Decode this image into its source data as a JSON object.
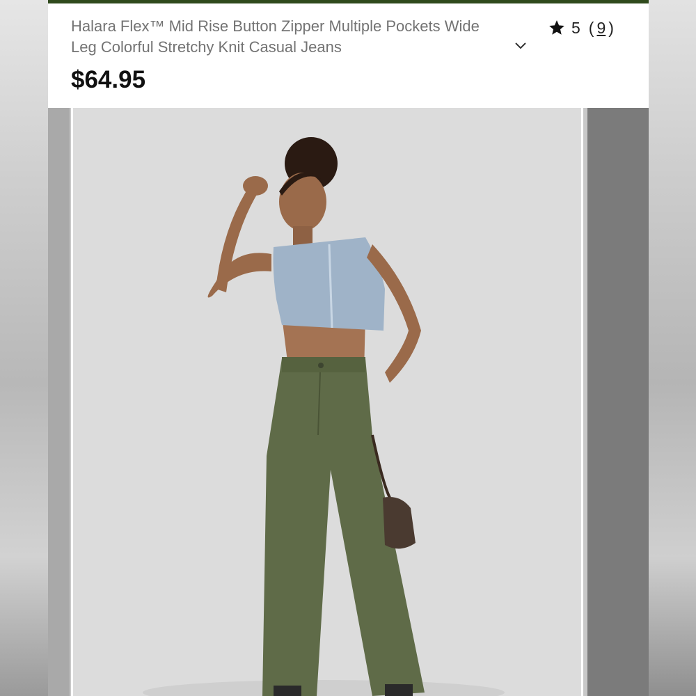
{
  "product": {
    "title": "Halara Flex™ Mid Rise Button Zipper Multiple Pockets Wide Leg Colorful Stretchy Knit Casual Jeans",
    "price": "$64.95",
    "rating": "5",
    "review_count": "9",
    "open_paren": "(",
    "close_paren": ")"
  },
  "icons": {
    "rating": "star-icon",
    "expand": "chevron-down-icon"
  },
  "colors": {
    "accent_bar": "#2f4a1c",
    "pants": "#5f6b48",
    "top": "#9fb3c8"
  },
  "gallery": {
    "image_alt": "model wearing olive wide leg pants and cropped denim vest"
  }
}
